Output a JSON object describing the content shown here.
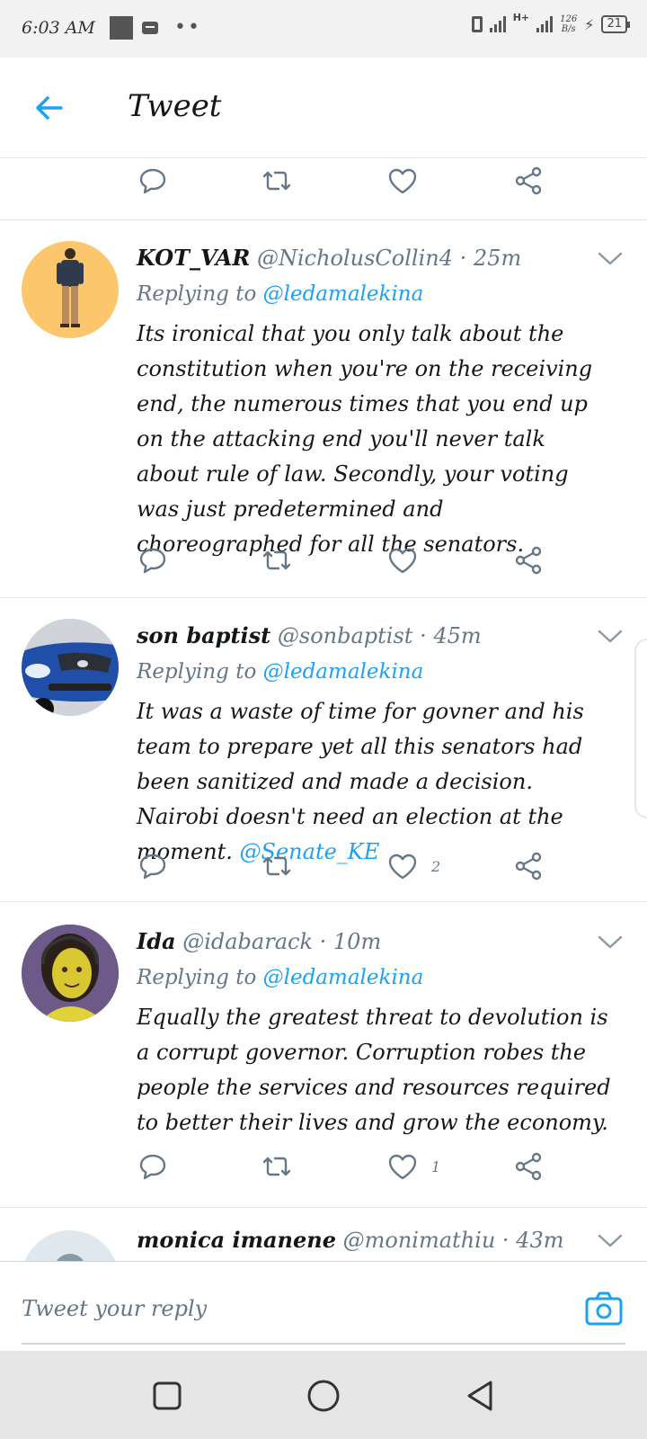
{
  "status_bar": {
    "time": "6:03 AM",
    "network": "H+",
    "speed_value": "126",
    "speed_unit": "B/s",
    "battery": "21"
  },
  "header": {
    "title": "Tweet"
  },
  "tweets": [
    {
      "name": "KOT_VAR",
      "handle": "@NicholusCollin4",
      "time": "25m",
      "replying_prefix": "Replying to",
      "replying_to": "@ledamalekina",
      "text": "Its ironical that you only talk about the constitution when you're on the receiving end, the numerous times that you end up on the attacking end you'll never talk about rule of law. Secondly, your voting was just predetermined and choreographed for all the senators.",
      "mention": "",
      "likes": ""
    },
    {
      "name": "son baptist",
      "handle": "@sonbaptist",
      "time": "45m",
      "replying_prefix": "Replying to",
      "replying_to": "@ledamalekina",
      "text": "It was a waste of time for govner and his team to prepare yet all this senators had been sanitized and made a decision. Nairobi doesn't need an election at the moment. ",
      "mention": "@Senate_KE",
      "likes": "2"
    },
    {
      "name": "Ida",
      "handle": "@idabarack",
      "time": "10m",
      "replying_prefix": "Replying to",
      "replying_to": "@ledamalekina",
      "text": "Equally the greatest threat to devolution is a corrupt governor. Corruption robes the people the services and resources required to better their lives and grow the economy.",
      "mention": "",
      "likes": "1"
    },
    {
      "name": "monica imanene",
      "handle": "@monimathiu",
      "time": "43m"
    }
  ],
  "reply_bar": {
    "placeholder": "Tweet your reply"
  },
  "colors": {
    "accent": "#1da1f2",
    "muted": "#657786",
    "text": "#14171a",
    "divider": "#e1e8ed"
  },
  "icons": [
    "back-arrow-icon",
    "reply-icon",
    "retweet-icon",
    "like-icon",
    "share-icon",
    "chevron-down-icon",
    "camera-icon",
    "square-nav-icon",
    "circle-nav-icon",
    "triangle-back-nav-icon"
  ]
}
